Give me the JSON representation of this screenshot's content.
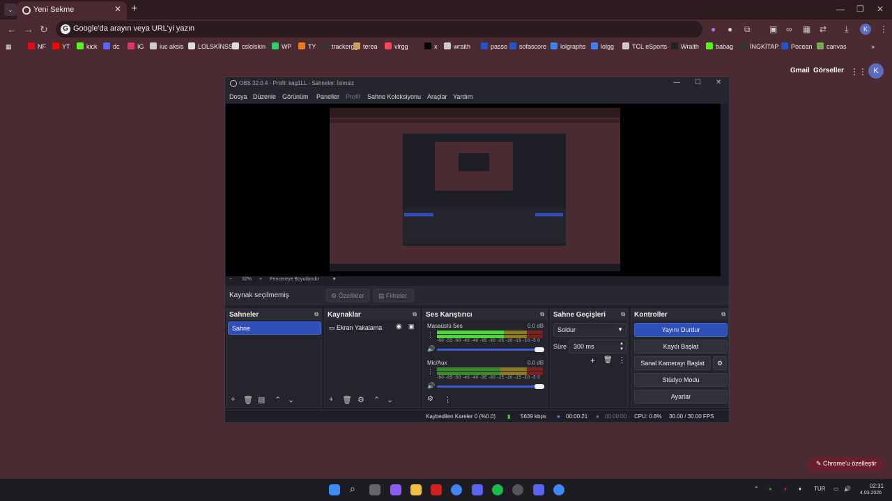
{
  "browser": {
    "tab_title": "Yeni Sekme",
    "omnibox_placeholder": "Google'da arayın veya URL'yi yazın",
    "profile_initial": "K",
    "bookmarks": [
      "NF",
      "YT",
      "kick",
      "dc",
      "IG",
      "iuc aksis",
      "LOLSKİNSS",
      "cslolskin",
      "WP",
      "TY",
      "trackergg",
      "terea",
      "vlrgg",
      "x",
      "wraith",
      "passo",
      "sofascore",
      "lolgraphs",
      "lolgg",
      "TCL eSports",
      "Wraith",
      "babag",
      "İNGKİTAP",
      "Pocean",
      "canvas"
    ],
    "bookmark_colors": [
      "#e50914",
      "#ff0000",
      "#53fc18",
      "#5865f2",
      "#e1306c",
      "#cccccc",
      "#dddddd",
      "#dddddd",
      "#25d366",
      "#f27a1a",
      "#333333",
      "#c8a060",
      "#ff4655",
      "#000000",
      "#cccccc",
      "#2255cc",
      "#2255cc",
      "#3b82f6",
      "#3b82f6",
      "#cccccc",
      "#222222",
      "#53fc18",
      "#333333",
      "#2255cc",
      "#77aa55"
    ]
  },
  "google": {
    "gmail": "Gmail",
    "images": "Görseller",
    "avatar": "K",
    "customize_label": "Chrome'u özelleştir"
  },
  "obs": {
    "title": "OBS 32.0.4 - Profil: kag1LL - Sahneler: İsimsiz",
    "menu": [
      "Dosya",
      "Düzenle",
      "Görünüm",
      "Paneller",
      "Profil",
      "Sahne Koleksiyonu",
      "Araçlar",
      "Yardım"
    ],
    "zoom": {
      "minus": "−",
      "value": "32%",
      "plus": "+",
      "fit": "Pencereye Boyutlandır"
    },
    "no_source": "Kaynak seçilmemiş",
    "properties_btn": "Özellikler",
    "filters_btn": "Filtreler",
    "scenes": {
      "title": "Sahneler",
      "items": [
        "Sahne"
      ]
    },
    "sources": {
      "title": "Kaynaklar",
      "items": [
        "Ekran Yakalama"
      ]
    },
    "mixer": {
      "title": "Ses Karıştırıcı",
      "channels": [
        {
          "name": "Masaüstü Ses",
          "db": "0.0 dB"
        },
        {
          "name": "Mic/Aux",
          "db": "0.0 dB"
        }
      ],
      "scale": "-60 -55 -50 -45 -40 -35 -30 -25 -20 -15 -10 -5 0"
    },
    "transitions": {
      "title": "Sahne Geçişleri",
      "selected": "Soldur",
      "duration_label": "Süre",
      "duration_value": "300 ms"
    },
    "controls": {
      "title": "Kontroller",
      "buttons": [
        "Yayını Durdur",
        "Kaydı Başlat",
        "Sanal Kamerayı Başlat",
        "Stüdyo Modu",
        "Ayarlar"
      ]
    },
    "status": {
      "dropped": "Kaybedilen Kareler 0 (%0.0)",
      "bitrate": "5639 kbps",
      "stream_time": "00:00:21",
      "rec_time": "00:00:00",
      "cpu": "CPU: 0.8%",
      "fps": "30.00 / 30.00 FPS"
    }
  },
  "taskbar": {
    "lang": "TUR",
    "time": "02:31",
    "date": "4.03.2026"
  }
}
